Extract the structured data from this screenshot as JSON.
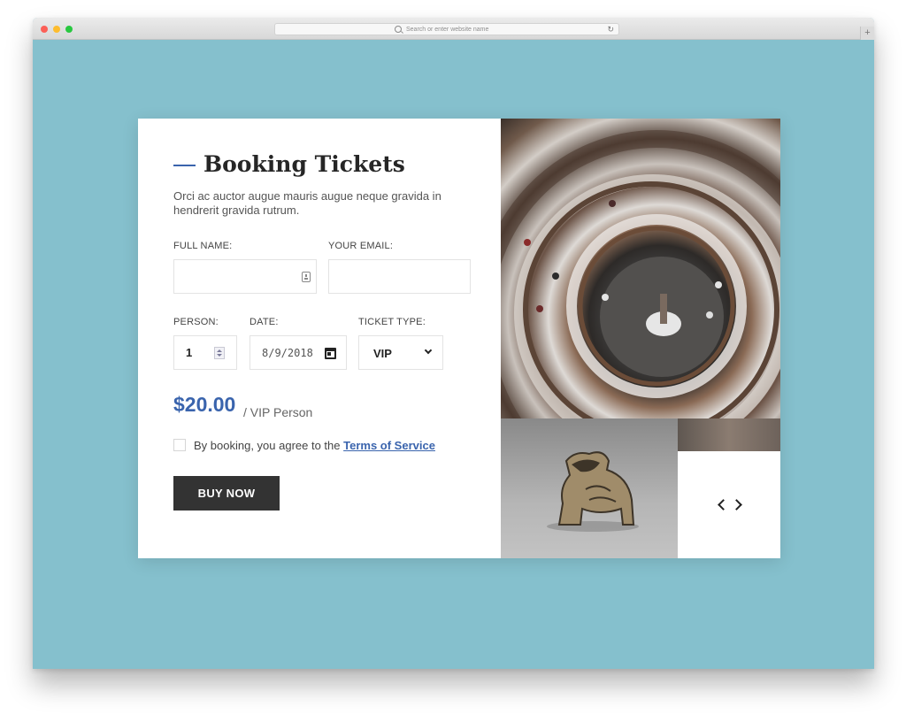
{
  "browser": {
    "address_placeholder": "Search or enter website name",
    "reload_icon": "↻",
    "newtab_icon": "+"
  },
  "booking": {
    "title": "Booking Tickets",
    "description": "Orci ac auctor augue mauris augue neque gravida in hendrerit gravida rutrum.",
    "full_name_label": "FULL NAME:",
    "email_label": "YOUR EMAIL:",
    "full_name_value": "",
    "email_value": "",
    "person_label": "PERSON:",
    "person_value": "1",
    "date_label": "DATE:",
    "date_value": "8/9/2018",
    "ticket_type_label": "TICKET TYPE:",
    "ticket_type_value": "VIP",
    "price": "$20.00",
    "price_unit": "/ VIP Person",
    "agree_text": "By booking, you agree to the ",
    "terms_link": "Terms of Service",
    "buy_button": "BUY NOW"
  },
  "colors": {
    "page_background": "#85c0cd",
    "accent": "#3a64ad",
    "button": "#333333"
  },
  "icons": [
    "contact-icon",
    "stepper-icon",
    "calendar-icon",
    "chevron-down-icon",
    "prev-arrow-icon",
    "next-arrow-icon"
  ]
}
